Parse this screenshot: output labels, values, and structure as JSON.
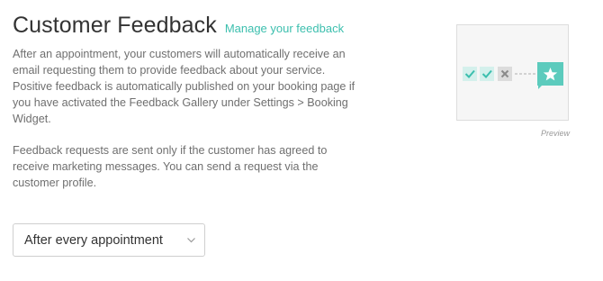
{
  "header": {
    "title": "Customer Feedback",
    "manage_link": "Manage your feedback"
  },
  "description": {
    "paragraph1": "After an appointment, your customers will automatically receive an email requesting them to provide feedback about your service. Positive feedback is automatically published on your booking page if you have activated the Feedback Gallery under Settings > Booking Widget.",
    "paragraph2": "Feedback requests are sent only if the customer has agreed to receive marketing messages. You can send a request via the customer profile."
  },
  "frequency_select": {
    "value": "After every appointment"
  },
  "preview": {
    "caption": "Preview",
    "icons": [
      "check-icon",
      "check-icon",
      "cross-icon",
      "star-icon"
    ]
  },
  "colors": {
    "accent": "#3cbfae",
    "accent_light": "#d4f0ec",
    "icon_grey": "#8a8a8a",
    "icon_grey_bg": "#dcdcdc",
    "preview_bg": "#f6f6f6"
  }
}
